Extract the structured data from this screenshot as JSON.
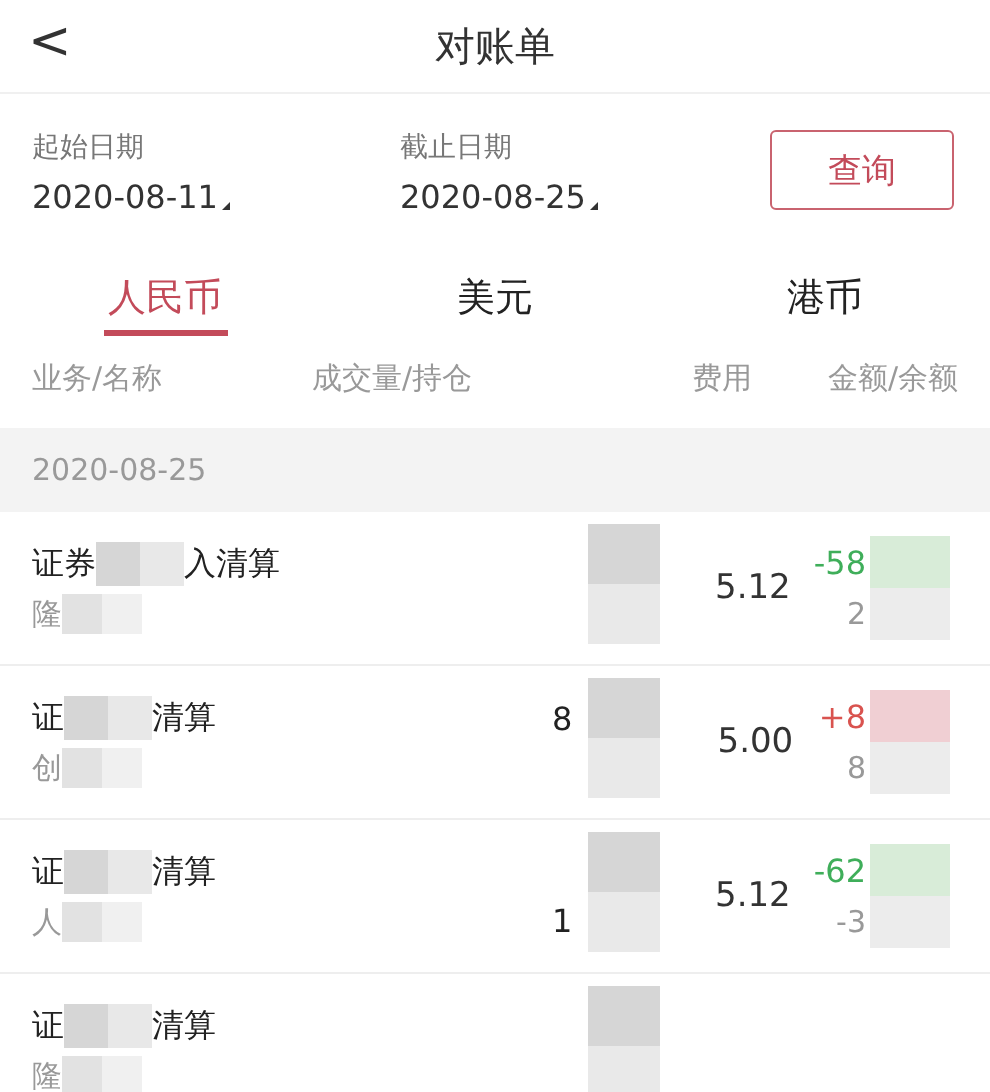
{
  "header": {
    "back": "<",
    "title": "对账单"
  },
  "filters": [
    {
      "label": "起始日期",
      "value": "2020-08-11"
    },
    {
      "label": "截止日期",
      "value": "2020-08-25"
    }
  ],
  "query_button": "查询",
  "tabs": [
    {
      "label": "人民币",
      "selected": true
    },
    {
      "label": "美元",
      "selected": false
    },
    {
      "label": "港币",
      "selected": false
    }
  ],
  "columns": [
    "业务/名称",
    "成交量/持仓",
    "费用",
    "金额/余额"
  ],
  "date_group": "2020-08-25",
  "rows": [
    {
      "kind": "debit",
      "business": [
        "证券",
        "入清算"
      ],
      "name": "隆",
      "fee": "5.12",
      "amount": "-58",
      "balance": "2"
    },
    {
      "kind": "credit",
      "business": [
        "证",
        "清算"
      ],
      "name": "创",
      "volume": "8",
      "fee": "5.00",
      "amount": "+8",
      "balance": "8"
    },
    {
      "kind": "debit",
      "business": [
        "证",
        "清算"
      ],
      "name": "人",
      "holding": "1",
      "fee": "5.12",
      "amount": "-62",
      "balance": "-3"
    },
    {
      "business": [
        "证",
        "清算"
      ],
      "name": "隆"
    }
  ]
}
